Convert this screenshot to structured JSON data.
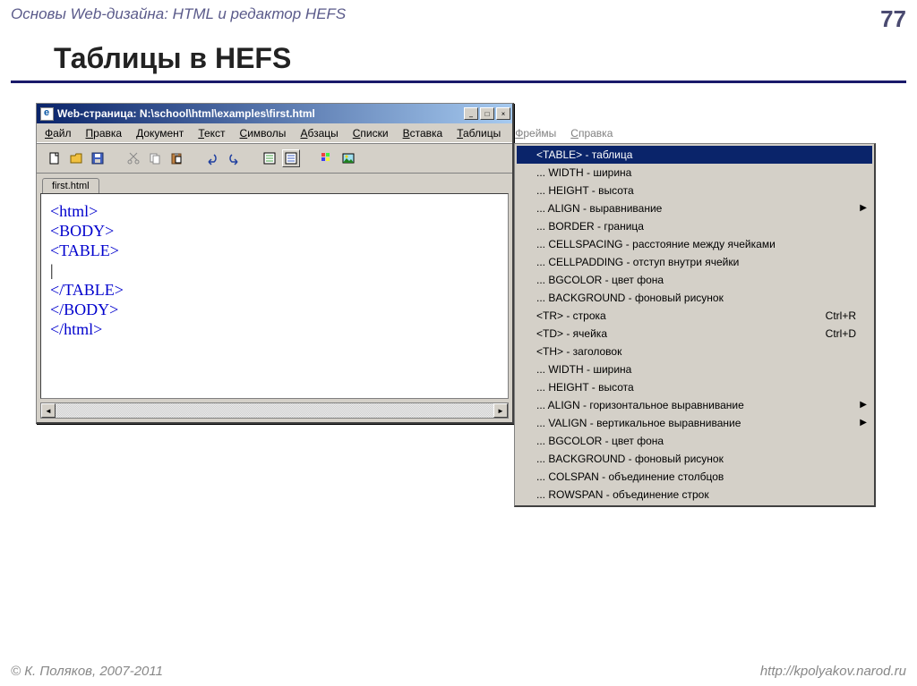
{
  "slide": {
    "header": "Основы Web-дизайна: HTML и редактор HEFS",
    "number": "77",
    "title": "Таблицы в HEFS",
    "copyright": "© К. Поляков, 2007-2011",
    "url": "http://kpolyakov.narod.ru"
  },
  "window": {
    "title": "Web-страница: N:\\school\\html\\examples\\first.html",
    "menubar": [
      "Файл",
      "Правка",
      "Документ",
      "Текст",
      "Символы",
      "Абзацы",
      "Списки",
      "Вставка",
      "Таблицы",
      "Фреймы",
      "Справка"
    ],
    "tab": "first.html",
    "code": [
      "<html>",
      "<BODY>",
      "<TABLE>",
      "|",
      "</TABLE>",
      "</BODY>",
      "</html>"
    ]
  },
  "dropdown": [
    {
      "label": "<TABLE> - таблица",
      "sel": true
    },
    {
      "label": "... WIDTH - ширина"
    },
    {
      "label": "... HEIGHT - высота"
    },
    {
      "label": "... ALIGN - выравнивание",
      "sub": true
    },
    {
      "label": "... BORDER - граница"
    },
    {
      "label": "... CELLSPACING - расстояние между ячейками"
    },
    {
      "label": "... CELLPADDING - отступ внутри ячейки"
    },
    {
      "label": "... BGCOLOR - цвет фона"
    },
    {
      "label": "... BACKGROUND - фоновый рисунок"
    },
    {
      "label": "<TR> - строка",
      "shortcut": "Ctrl+R"
    },
    {
      "label": "<TD> - ячейка",
      "shortcut": "Ctrl+D"
    },
    {
      "label": "<TH> - заголовок"
    },
    {
      "label": "... WIDTH - ширина"
    },
    {
      "label": "... HEIGHT - высота"
    },
    {
      "label": "... ALIGN - горизонтальное выравнивание",
      "sub": true
    },
    {
      "label": "... VALIGN - вертикальное выравнивание",
      "sub": true
    },
    {
      "label": "... BGCOLOR - цвет фона"
    },
    {
      "label": "... BACKGROUND - фоновый рисунок"
    },
    {
      "label": "... COLSPAN - объединение столбцов"
    },
    {
      "label": "... ROWSPAN - объединение строк"
    }
  ],
  "toolbar_icons": [
    "new",
    "open",
    "save",
    "cut",
    "copy",
    "paste",
    "undo",
    "redo",
    "list1",
    "list2",
    "grid",
    "image"
  ]
}
